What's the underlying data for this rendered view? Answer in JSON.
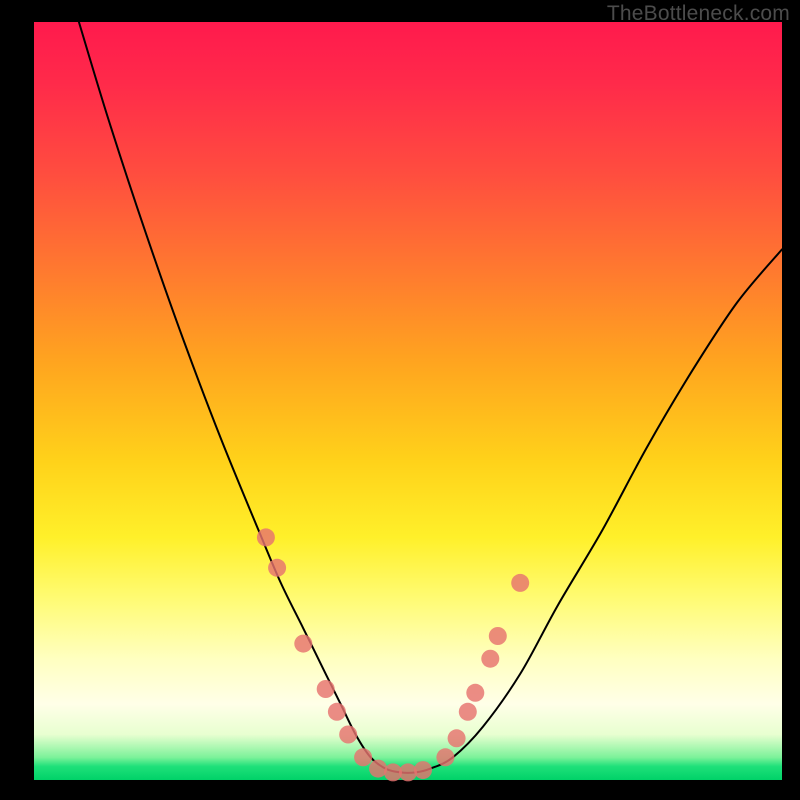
{
  "watermark": "TheBottleneck.com",
  "colors": {
    "frame": "#000000",
    "curve": "#000000",
    "dots": "#e6736f",
    "gradient_top": "#ff1a4d",
    "gradient_bottom": "#00d268"
  },
  "chart_data": {
    "type": "line",
    "title": "",
    "xlabel": "",
    "ylabel": "",
    "xlim": [
      0,
      100
    ],
    "ylim": [
      0,
      100
    ],
    "note": "No numeric axes or tick labels are rendered in the image; values below are pixel-relative estimates (0–100 each axis, y=0 at bottom).",
    "series": [
      {
        "name": "bottleneck-curve",
        "x": [
          6,
          10,
          15,
          20,
          25,
          30,
          33,
          36,
          39,
          41,
          43,
          45,
          47,
          49,
          51,
          53,
          56,
          60,
          65,
          70,
          76,
          82,
          88,
          94,
          100
        ],
        "y": [
          100,
          87,
          72,
          58,
          45,
          33,
          26,
          20,
          14,
          10,
          6,
          3,
          1.5,
          1,
          1,
          1.5,
          3,
          7,
          14,
          23,
          33,
          44,
          54,
          63,
          70
        ]
      }
    ],
    "markers": {
      "name": "highlighted-points",
      "note": "Salmon dots clustered near the valley on both arms of the curve; coordinates are pixel-relative (0–100).",
      "points": [
        {
          "x": 31,
          "y": 32
        },
        {
          "x": 32.5,
          "y": 28
        },
        {
          "x": 36,
          "y": 18
        },
        {
          "x": 39,
          "y": 12
        },
        {
          "x": 40.5,
          "y": 9
        },
        {
          "x": 42,
          "y": 6
        },
        {
          "x": 44,
          "y": 3
        },
        {
          "x": 46,
          "y": 1.5
        },
        {
          "x": 48,
          "y": 1
        },
        {
          "x": 50,
          "y": 1
        },
        {
          "x": 52,
          "y": 1.3
        },
        {
          "x": 55,
          "y": 3
        },
        {
          "x": 56.5,
          "y": 5.5
        },
        {
          "x": 58,
          "y": 9
        },
        {
          "x": 59,
          "y": 11.5
        },
        {
          "x": 61,
          "y": 16
        },
        {
          "x": 62,
          "y": 19
        },
        {
          "x": 65,
          "y": 26
        }
      ]
    }
  }
}
